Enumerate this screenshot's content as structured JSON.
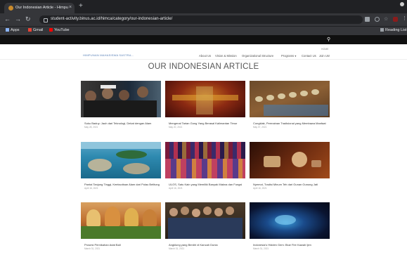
{
  "browser": {
    "tab_title": "Our Indonesian Article - Himpu",
    "url": "student-activity.binus.ac.id/himca/category/our-indonesian-article/",
    "bookmarks": [
      "Apps",
      "Gmail",
      "YouTube"
    ],
    "reading_list": "Reading List"
  },
  "site": {
    "logo": "HIMPUNAN MAHASISWA SASTRA...",
    "nav": [
      "About Us",
      "Vision & Mission",
      "Organizational Structure",
      "Programs",
      "Contact Us",
      "Join Us!"
    ],
    "breadcrumb": "HOME",
    "page_title": "OUR INDONESIAN ARTICLE"
  },
  "articles": [
    {
      "title": "Suku Baduy: Jauh dari Teknologi, Dekat dengan Alam",
      "date": "May 28, 2021"
    },
    {
      "title": "Mengenal Tarian Gong Yang Berasal Kalimantan Timur",
      "date": "May 20, 2021"
    },
    {
      "title": "Congklak, Permainan Tradisional yang Membawa Manfaat",
      "date": "May 07, 2021"
    },
    {
      "title": "Pantai Tanjung Tinggi, Keeksotisan Alam dari Pulau Belitung",
      "date": "April 16, 2021"
    },
    {
      "title": "ULOS, Satu Kain yang Memiliki Banyak Makna dan Fungsi",
      "date": "April 16, 2021"
    },
    {
      "title": "Nyemot, Tradisi Minum Teh dari Gunan Gunung Jati",
      "date": "April 16, 2021"
    },
    {
      "title": "Prosesi Pernikahan Adat Bali",
      "date": "March 31, 2021"
    },
    {
      "title": "Angklung yang Berdiri di Kancah Dunia",
      "date": "March 31, 2021"
    },
    {
      "title": "Indonesia's Hidden Gem: Blue Fire Kawah Ijen",
      "date": "March 31, 2021"
    }
  ]
}
